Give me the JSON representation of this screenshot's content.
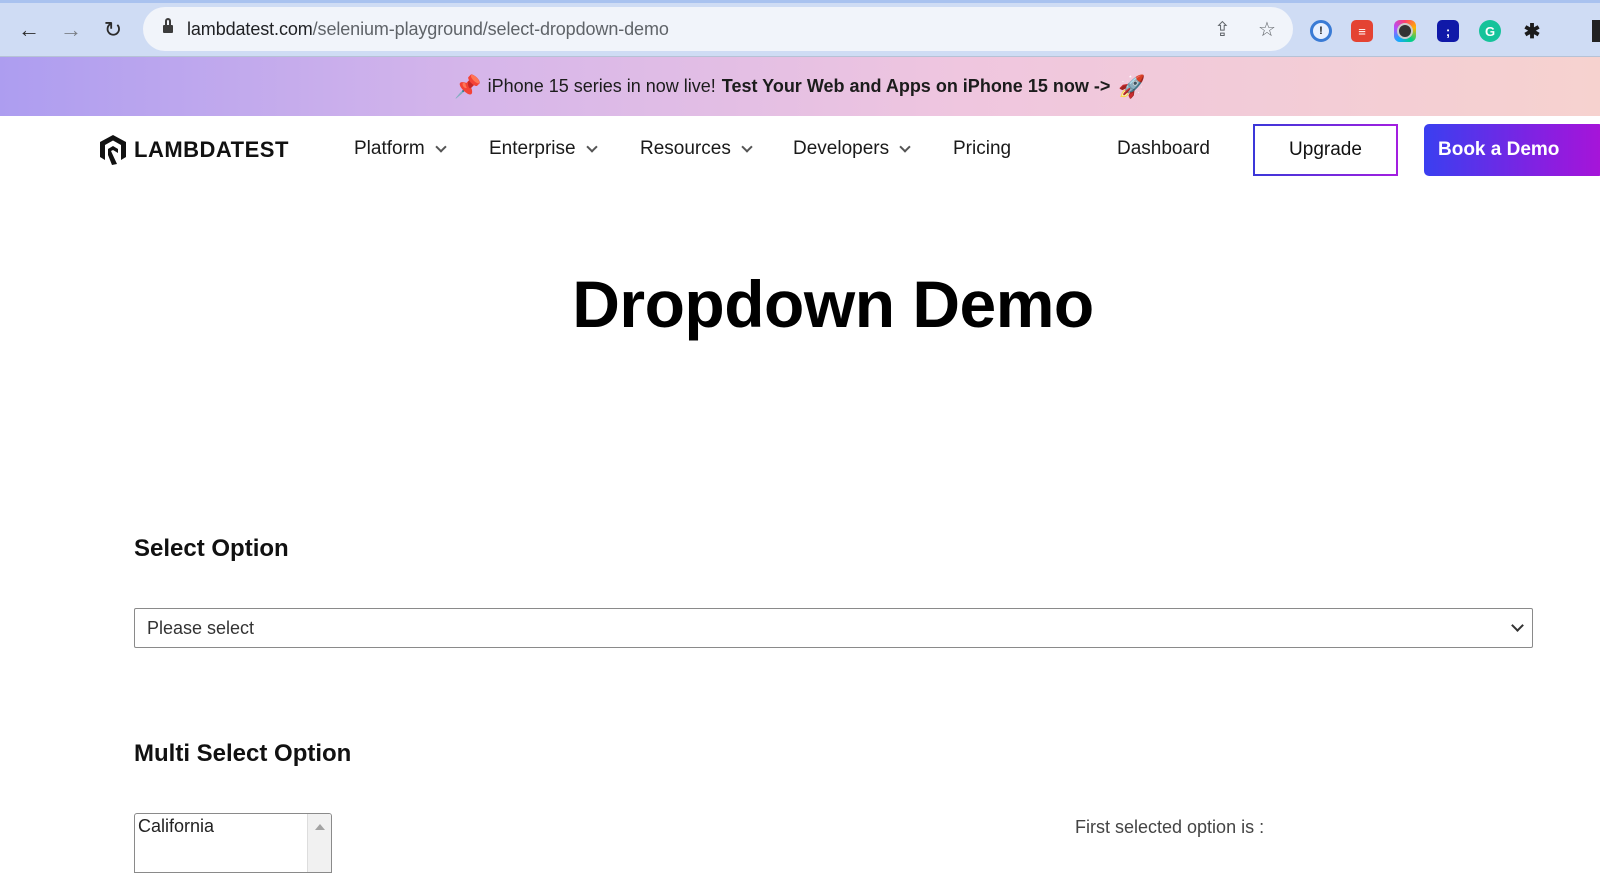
{
  "browser": {
    "url_host": "lambdatest.com",
    "url_path": "/selenium-playground/select-dropdown-demo",
    "icons": {
      "back": "arrow-left-icon",
      "forward": "arrow-right-icon",
      "reload": "reload-icon",
      "lock": "lock-icon",
      "share": "share-icon",
      "bookmark": "star-icon"
    },
    "extensions": [
      "password-manager-extension",
      "todoist-extension",
      "camera-extension",
      "semicolon-extension",
      "grammarly-extension",
      "extensions-puzzle-icon"
    ],
    "glyphs": {
      "back": "←",
      "forward": "→",
      "reload": "↻",
      "share": "⇪",
      "star": "☆",
      "semi": ";",
      "gram": "G",
      "puzzle": "✱",
      "todoist": "≡",
      "one": "!"
    }
  },
  "promo": {
    "pin_glyph": "📌",
    "text": "iPhone 15 series in now live!",
    "link_text": "Test Your Web and Apps on iPhone 15 now ->",
    "rocket_glyph": "🚀"
  },
  "nav": {
    "logo_text": "LAMBDATEST",
    "items": [
      {
        "label": "Platform",
        "has_dropdown": true
      },
      {
        "label": "Enterprise",
        "has_dropdown": true
      },
      {
        "label": "Resources",
        "has_dropdown": true
      },
      {
        "label": "Developers",
        "has_dropdown": true
      },
      {
        "label": "Pricing",
        "has_dropdown": false
      }
    ],
    "dashboard_label": "Dashboard",
    "upgrade_label": "Upgrade",
    "book_demo_label": "Book a Demo",
    "colors": {
      "accent_start": "#3a3ff0",
      "accent_end": "#a814d8"
    }
  },
  "main": {
    "title": "Dropdown Demo",
    "select_section": {
      "title": "Select Option",
      "selected_value": "Please select"
    },
    "multi_section": {
      "title": "Multi Select Option",
      "visible_options": [
        "California"
      ],
      "first_selected_label": "First selected option is :"
    }
  }
}
